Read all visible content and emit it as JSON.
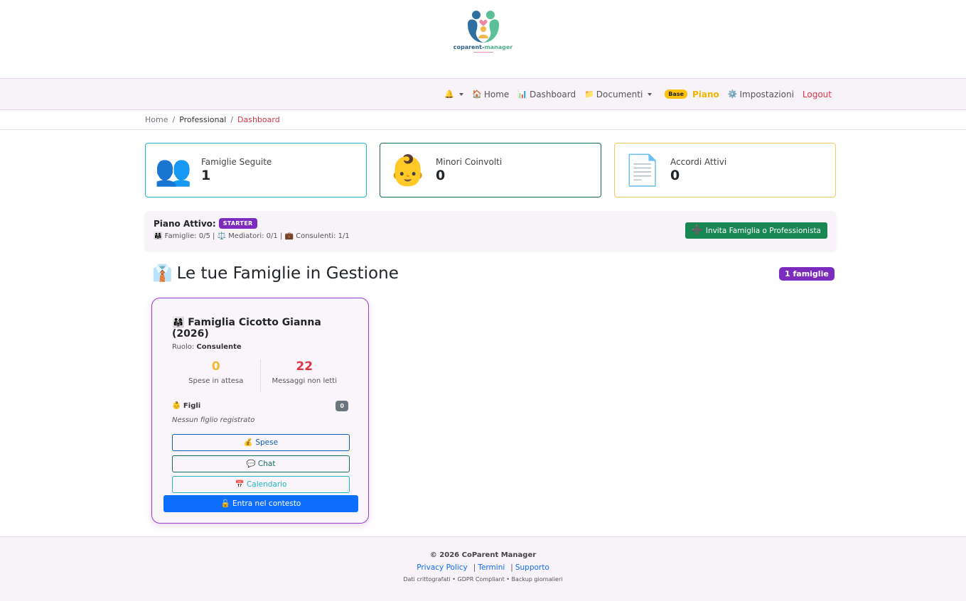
{
  "brand": {
    "name_part1": "coparent-",
    "name_part2": "manager",
    "logo_icon": "family-hearts-logo"
  },
  "nav": {
    "bell_icon": "bell-icon",
    "home": {
      "icon": "🏠",
      "label": "Home"
    },
    "dashboard": {
      "icon": "📊",
      "label": "Dashboard"
    },
    "documenti": {
      "icon": "📁",
      "label": "Documenti"
    },
    "plan_badge": "Base",
    "piano": "Piano",
    "impostazioni": {
      "icon": "⚙️",
      "label": "Impostazioni"
    },
    "logout": "Logout"
  },
  "breadcrumb": {
    "home": "Home",
    "section": "Professional",
    "current": "Dashboard"
  },
  "stats": [
    {
      "icon": "👥",
      "label": "Famiglie Seguite",
      "value": "1"
    },
    {
      "icon": "👶",
      "label": "Minori Coinvolti",
      "value": "0"
    },
    {
      "icon": "📄",
      "label": "Accordi Attivi",
      "value": "0"
    }
  ],
  "plan": {
    "title": "Piano Attivo:",
    "badge": "STARTER",
    "quota": "👨‍👩‍👧 Famiglie: 0/5 | ⚖️ Mediatori: 0/1 | 💼 Consulenti: 1/1",
    "invite_icon": "➕",
    "invite_label": "Invita Famiglia o Professionista"
  },
  "section": {
    "icon": "👔",
    "title": "Le tue Famiglie in Gestione",
    "count_badge": "1 famiglie"
  },
  "family": {
    "name": "👨‍👩‍👧 Famiglia Cicotto Gianna (2026)",
    "role_label": "Ruolo:",
    "role_value": "Consulente",
    "stat1_value": "0",
    "stat1_label": "Spese in attesa",
    "stat2_value": "22",
    "stat2_label": "Messaggi non letti",
    "figli_label": "👶 Figli",
    "figli_count": "0",
    "no_children": "Nessun figlio registrato",
    "btn_spese": "💰 Spese",
    "btn_chat": "💬 Chat",
    "btn_calendario": "📅 Calendario",
    "btn_enter": "🔓 Entra nel contesto"
  },
  "footer": {
    "copyright": "© 2026 CoParent Manager",
    "privacy": "Privacy Policy",
    "termini": "Termini",
    "supporto": "Supporto",
    "note": "Dati crittografati • GDPR Compliant • Backup giornalieri"
  }
}
